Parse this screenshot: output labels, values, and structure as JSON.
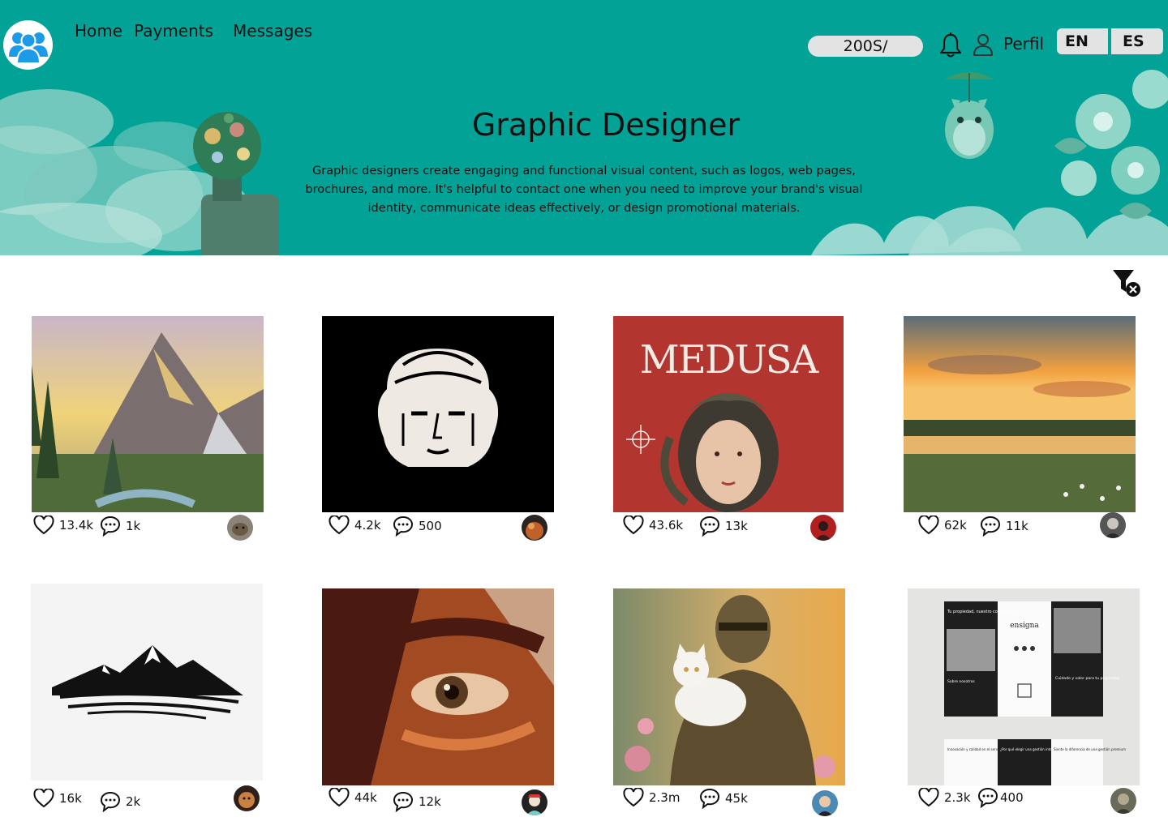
{
  "nav": {
    "home": "Home",
    "payments": "Payments",
    "messages": "Messages"
  },
  "header": {
    "balance": "200S/",
    "profile_label": "Perfil",
    "lang_en": "EN",
    "lang_es": "ES"
  },
  "hero": {
    "title": "Graphic Designer",
    "description": "Graphic designers create engaging and functional visual content, such as logos, web pages, brochures, and more. It's helpful to contact one when you need to improve your brand's visual identity, communicate ideas effectively, or design promotional materials."
  },
  "colors": {
    "hero_bg": "#02a396",
    "pill_bg": "#e3e3e3",
    "logo_people": "#1e9be8"
  },
  "icons": {
    "logo": "people-group-icon",
    "notifications": "bell-icon",
    "profile": "user-icon",
    "filter": "filter-clear-icon",
    "like": "heart-icon",
    "comment": "comment-icon"
  },
  "posts": [
    {
      "subject": "mountain landscape painting",
      "likes": "13.4k",
      "comments": "1k"
    },
    {
      "subject": "medusa logo",
      "likes": "4.2k",
      "comments": "500"
    },
    {
      "subject": "medusa poster",
      "poster_text": "MEDUSA",
      "likes": "43.6k",
      "comments": "13k"
    },
    {
      "subject": "sunset meadow painting",
      "likes": "62k",
      "comments": "11k"
    },
    {
      "subject": "mountain logo",
      "likes": "16k",
      "comments": "2k"
    },
    {
      "subject": "eye oil painting",
      "likes": "44k",
      "comments": "12k"
    },
    {
      "subject": "knight with cat painting",
      "likes": "2.3m",
      "comments": "45k"
    },
    {
      "subject": "real estate brochure",
      "likes": "2.3k",
      "comments": "400",
      "brochure": {
        "tagline": "Tu propiedad, nuestro compromiso",
        "brand": "ensigna",
        "about": "Sobre nosotros",
        "headline": "Cuidado y valor para tu propiedad",
        "panel_a": "Innovación y calidad en el servicio",
        "panel_b": "¿Por qué elegir una gestión integral inmobiliaria?",
        "panel_c": "Siente la diferencia de una gestión premium"
      }
    }
  ]
}
